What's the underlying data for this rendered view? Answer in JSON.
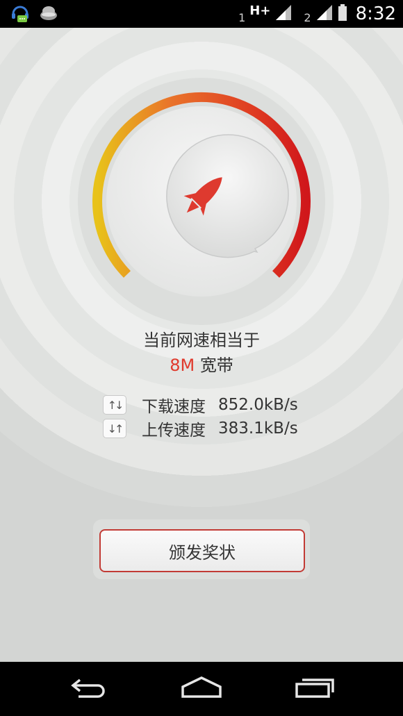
{
  "status_bar": {
    "sim1": "1",
    "network_type": "H+",
    "sim2": "2",
    "time": "8:32",
    "icons": [
      "headset-chat-notification-icon",
      "cloud-notification-icon",
      "signal-icon",
      "signal-icon",
      "battery-icon"
    ]
  },
  "speedtest": {
    "center_icon": "rocket-icon",
    "result_line1": "当前网速相当于",
    "result_speed": "8M",
    "result_unit": "宽带",
    "download": {
      "arrows": "↑↓",
      "label": "下载速度",
      "value": "852.0kB/s"
    },
    "upload": {
      "arrows": "↓↑",
      "label": "上传速度",
      "value": "383.1kB/s"
    },
    "award_button": "颁发奖状"
  },
  "nav_bar": {
    "back": "back-icon",
    "home": "home-icon",
    "recents": "recents-icon"
  },
  "colors": {
    "accent": "#e03a2d",
    "gauge_start": "#e8c21a",
    "gauge_mid": "#e9742a",
    "gauge_end": "#d0171b"
  }
}
